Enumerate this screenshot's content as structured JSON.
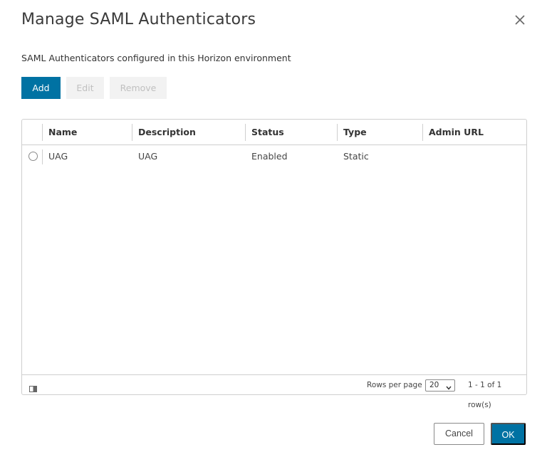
{
  "dialog": {
    "title": "Manage SAML Authenticators",
    "subtitle": "SAML Authenticators configured in this Horizon environment",
    "close_icon": "close-icon"
  },
  "toolbar": {
    "add_label": "Add",
    "edit_label": "Edit",
    "remove_label": "Remove"
  },
  "table": {
    "columns": [
      "Name",
      "Description",
      "Status",
      "Type",
      "Admin URL"
    ],
    "rows": [
      {
        "name": "UAG",
        "description": "UAG",
        "status": "Enabled",
        "type": "Static",
        "admin_url": ""
      }
    ]
  },
  "footer": {
    "column_toggle_icon": "columns-icon",
    "rows_per_page_label": "Rows per page",
    "rows_per_page_value": "20",
    "pagination_text": "1 - 1 of 1 row(s)"
  },
  "actions": {
    "cancel_label": "Cancel",
    "ok_label": "OK"
  },
  "colors": {
    "primary": "#0072a3",
    "disabled_bg": "#f2f2f2",
    "disabled_text": "#c0c0c0",
    "border": "#cfcfcf"
  }
}
